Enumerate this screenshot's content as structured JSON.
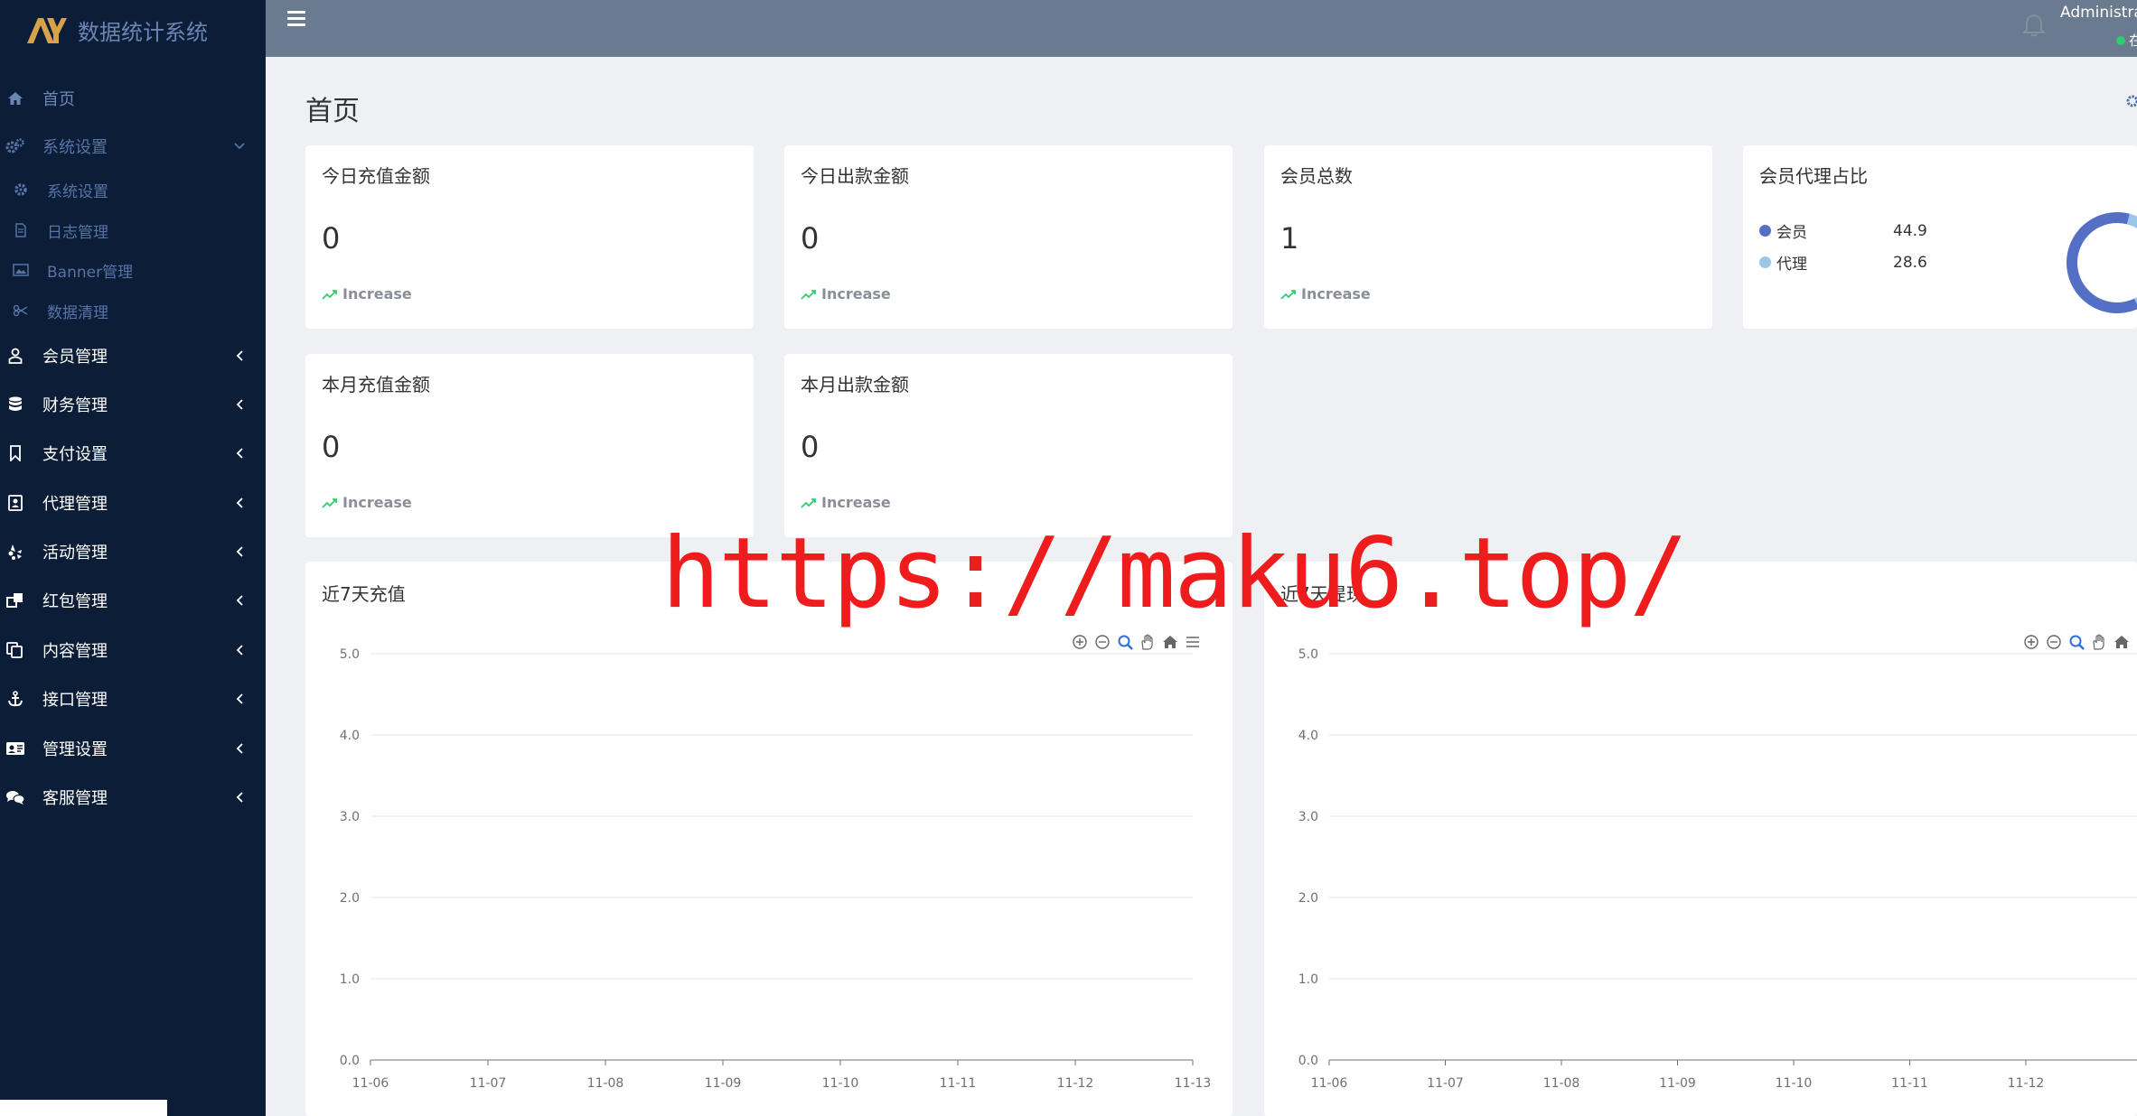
{
  "brand": {
    "name": "数据统计系统",
    "logo": "AY"
  },
  "sidebar": {
    "items": [
      {
        "label": "首页",
        "icon": "home-icon"
      },
      {
        "label": "系统设置",
        "icon": "gears-icon"
      },
      {
        "label": "系统设置",
        "icon": "gear-icon"
      },
      {
        "label": "日志管理",
        "icon": "file-icon"
      },
      {
        "label": "Banner管理",
        "icon": "image-icon"
      },
      {
        "label": "数据清理",
        "icon": "scissors-icon"
      },
      {
        "label": "会员管理",
        "icon": "user-icon"
      },
      {
        "label": "财务管理",
        "icon": "database-icon"
      },
      {
        "label": "支付设置",
        "icon": "bookmark-icon"
      },
      {
        "label": "代理管理",
        "icon": "contact-icon"
      },
      {
        "label": "活动管理",
        "icon": "yelp-icon"
      },
      {
        "label": "红包管理",
        "icon": "clone-icon"
      },
      {
        "label": "内容管理",
        "icon": "copy-icon"
      },
      {
        "label": "接口管理",
        "icon": "anchor-icon"
      },
      {
        "label": "管理设置",
        "icon": "id-card-icon"
      },
      {
        "label": "客服管理",
        "icon": "comments-icon"
      }
    ]
  },
  "header": {
    "user": "Administra",
    "status": "在"
  },
  "page": {
    "title": "首页"
  },
  "cards": [
    {
      "title": "今日充值金额",
      "value": "0",
      "trend": "Increase"
    },
    {
      "title": "今日出款金额",
      "value": "0",
      "trend": "Increase"
    },
    {
      "title": "会员总数",
      "value": "1",
      "trend": "Increase"
    },
    {
      "title": "本月充值金额",
      "value": "0",
      "trend": "Increase"
    },
    {
      "title": "本月出款金额",
      "value": "0",
      "trend": "Increase"
    }
  ],
  "pie": {
    "title": "会员代理占比",
    "legend": [
      {
        "name": "会员",
        "value": "44.9",
        "color": "#5470c6"
      },
      {
        "name": "代理",
        "value": "28.6",
        "color": "#9cc5ea"
      }
    ]
  },
  "panels": [
    {
      "title": "近7天充值"
    },
    {
      "title": "近7天提现"
    }
  ],
  "chart_data": [
    {
      "type": "line",
      "title": "近7天充值",
      "x": [
        "11-06",
        "11-07",
        "11-08",
        "11-09",
        "11-10",
        "11-11",
        "11-12",
        "11-13"
      ],
      "yticks": [
        "0.0",
        "1.0",
        "2.0",
        "3.0",
        "4.0",
        "5.0"
      ],
      "ylim": [
        0,
        5
      ],
      "series": [],
      "grid": true,
      "toolbox": [
        "zoom-in-icon",
        "zoom-out-icon",
        "search-zoom-icon",
        "hand-pan-icon",
        "home-reset-icon",
        "menu-icon"
      ]
    },
    {
      "type": "line",
      "title": "近7天提现",
      "x": [
        "11-06",
        "11-07",
        "11-08",
        "11-09",
        "11-10",
        "11-11",
        "11-12"
      ],
      "yticks": [
        "0.0",
        "1.0",
        "2.0",
        "3.0",
        "4.0",
        "5.0"
      ],
      "ylim": [
        0,
        5
      ],
      "series": [],
      "grid": true,
      "toolbox": [
        "zoom-in-icon",
        "zoom-out-icon",
        "search-zoom-icon",
        "hand-pan-icon",
        "home-reset-icon"
      ]
    }
  ],
  "watermark": "https://maku6.top/",
  "colors": {
    "sidebar": "#0c1d38",
    "header": "#6a7a8f",
    "trend": "#2ecc71",
    "watermark": "#ee1c1c"
  }
}
